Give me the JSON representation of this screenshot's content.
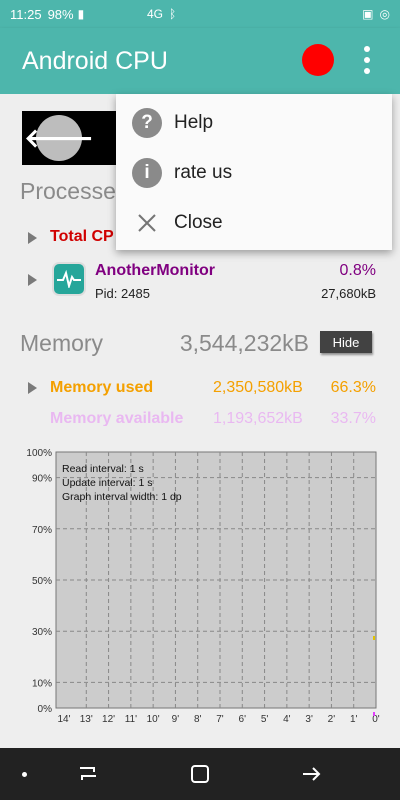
{
  "status_bar": {
    "time": "11:25",
    "battery": "98%",
    "network": "4G"
  },
  "app_bar": {
    "title": "Android CPU",
    "record_color": "#ff0000",
    "accent": "#4db6ac"
  },
  "processes": {
    "title": "Processe",
    "total_cpu_label": "Total CP",
    "rows": [
      {
        "name": "AnotherMonitor",
        "pid_text": "Pid: 2485",
        "cpu": "0.8%",
        "memory": "27,680kB"
      }
    ]
  },
  "memory": {
    "title": "Memory",
    "total": "3,544,232kB",
    "hide_label": "Hide",
    "used_label": "Memory used",
    "used_value": "2,350,580kB",
    "used_percent": "66.3%",
    "available_label": "Memory available",
    "available_value": "1,193,652kB",
    "available_percent": "33.7%"
  },
  "graph": {
    "info_lines": [
      "Read interval: 1 s",
      "Update interval: 1 s",
      "Graph interval width: 1 dp"
    ],
    "y_ticks": [
      "100%",
      "90%",
      "70%",
      "50%",
      "30%",
      "10%",
      "0%"
    ],
    "x_ticks": [
      "14'",
      "13'",
      "12'",
      "11'",
      "10'",
      "9'",
      "8'",
      "7'",
      "6'",
      "5'",
      "4'",
      "3'",
      "2'",
      "1'",
      "0'"
    ]
  },
  "overflow_menu": {
    "items": [
      {
        "icon": "help-icon",
        "label": "Help"
      },
      {
        "icon": "info-icon",
        "label": "rate us"
      },
      {
        "icon": "close-icon",
        "label": "Close"
      }
    ]
  },
  "colors": {
    "total_cpu": "#d00000",
    "process": "#800080",
    "memory_used": "#f4a000",
    "memory_available": "#e040fb"
  }
}
